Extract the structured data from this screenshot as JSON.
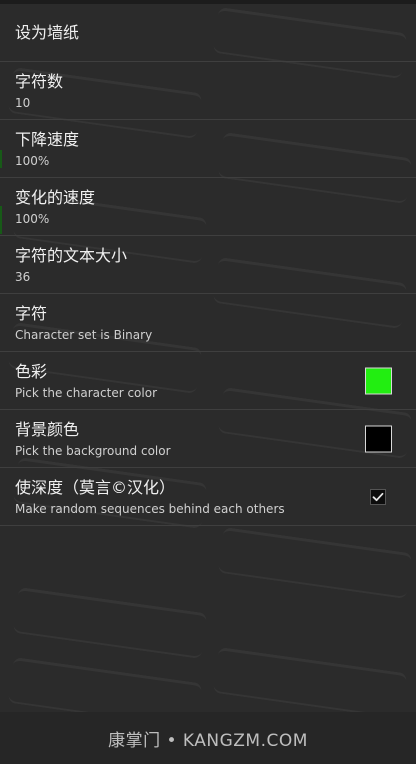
{
  "preferences": [
    {
      "title": "设为墙纸",
      "summary": ""
    },
    {
      "title": "字符数",
      "summary": "10"
    },
    {
      "title": "下降速度",
      "summary": "100%"
    },
    {
      "title": "变化的速度",
      "summary": "100%"
    },
    {
      "title": "字符的文本大小",
      "summary": "36"
    },
    {
      "title": "字符",
      "summary": "Character set is Binary"
    },
    {
      "title": "色彩",
      "summary": "Pick the character color",
      "color": "#22ee11"
    },
    {
      "title": "背景颜色",
      "summary": "Pick the background color",
      "color": "#000000"
    },
    {
      "title": "使深度（莫言©汉化）",
      "summary": "Make random sequences behind each others",
      "checked": true
    }
  ],
  "footer": {
    "watermark": "康掌门 • KANGZM.COM"
  }
}
